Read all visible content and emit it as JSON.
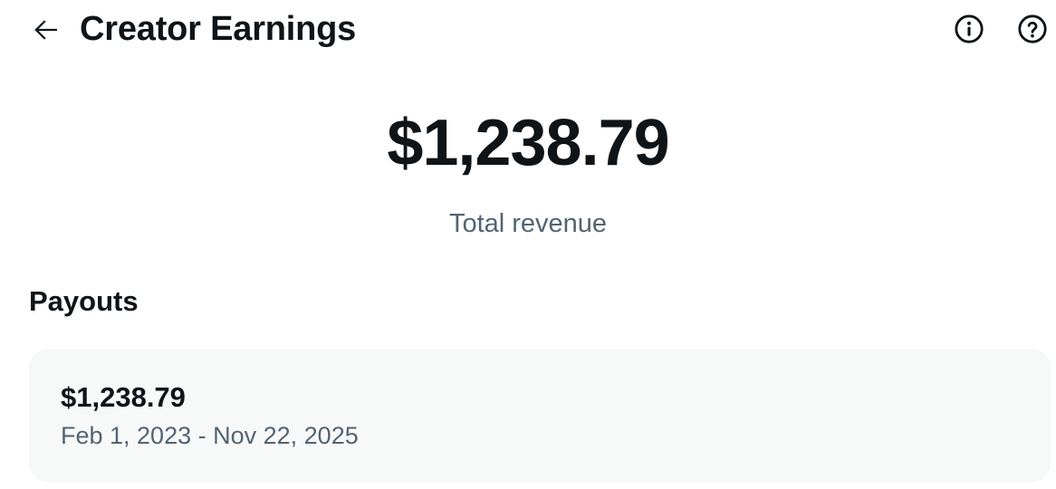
{
  "header": {
    "title": "Creator Earnings",
    "back_icon": "arrow-left-icon",
    "info_icon": "info-circle-icon",
    "help_icon": "question-circle-icon"
  },
  "summary": {
    "total_amount": "$1,238.79",
    "total_label": "Total revenue"
  },
  "payouts": {
    "section_title": "Payouts",
    "items": [
      {
        "amount": "$1,238.79",
        "date_range": "Feb 1, 2023 - Nov 22, 2025"
      }
    ]
  },
  "colors": {
    "text_primary": "#0f1419",
    "text_secondary": "#536471",
    "card_background": "#f7f9f9"
  }
}
